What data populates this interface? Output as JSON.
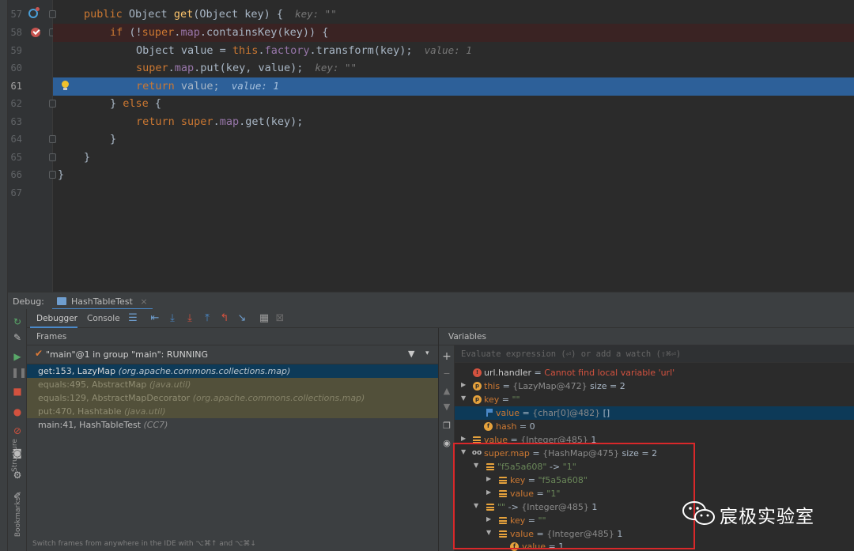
{
  "editor": {
    "lines": [
      {
        "num": "57",
        "code": {
          "kw1": "public",
          "t1": " Object ",
          "fn": "get",
          "t2": "(Object key) {",
          "hint": "  key: \"\""
        }
      },
      {
        "num": "58",
        "code": {
          "kw1": "if",
          "t1": " (!",
          "kw2": "super",
          "t2": ".",
          "fld": "map",
          "t3": ".containsKey(key)) {"
        }
      },
      {
        "num": "59",
        "code": {
          "t1": "Object value = ",
          "kw1": "this",
          "t2": ".",
          "fld": "factory",
          "t3": ".transform(key);",
          "hint": "  value: 1"
        }
      },
      {
        "num": "60",
        "code": {
          "kw1": "super",
          "t1": ".",
          "fld": "map",
          "t2": ".put(key, value);",
          "hint": "  key: \"\""
        }
      },
      {
        "num": "61",
        "code": {
          "kw1": "return",
          "t1": " value;",
          "hint": "  value: 1"
        }
      },
      {
        "num": "62",
        "code": {
          "t1": "} ",
          "kw1": "else",
          "t2": " {"
        }
      },
      {
        "num": "63",
        "code": {
          "kw1": "return",
          "t1": " ",
          "kw2": "super",
          "t2": ".",
          "fld": "map",
          "t3": ".get(key);"
        }
      },
      {
        "num": "64",
        "code": {
          "t1": "}"
        }
      },
      {
        "num": "65",
        "code": {
          "t1": "}"
        }
      },
      {
        "num": "66",
        "code": {
          "t1": "}"
        }
      },
      {
        "num": "67",
        "code": {
          "t1": ""
        }
      }
    ]
  },
  "debug": {
    "label": "Debug:",
    "tab": "HashTableTest",
    "close": "×",
    "toolbar": {
      "debugger": "Debugger",
      "console": "Console"
    },
    "side_labels": {
      "structure": "Structure",
      "bookmarks": "Bookmarks"
    }
  },
  "frames": {
    "header": "Frames",
    "thread": "\"main\"@1 in group \"main\": RUNNING",
    "items": [
      {
        "method": "get:153, LazyMap",
        "pkg": "(org.apache.commons.collections.map)"
      },
      {
        "method": "equals:495, AbstractMap",
        "pkg": "(java.util)"
      },
      {
        "method": "equals:129, AbstractMapDecorator",
        "pkg": "(org.apache.commons.collections.map)"
      },
      {
        "method": "put:470, Hashtable",
        "pkg": "(java.util)"
      },
      {
        "method": "main:41, HashTableTest",
        "pkg": "(CC7)"
      }
    ],
    "footer": "Switch frames from anywhere in the IDE with ⌥⌘↑ and ⌥⌘↓"
  },
  "variables": {
    "header": "Variables",
    "eval_placeholder": "Evaluate expression (⏎) or add a watch (⇧⌘⏎)",
    "rows": [
      {
        "name": "url.handler",
        "sep": " = ",
        "value": "Cannot find local variable 'url'"
      },
      {
        "name": "this",
        "sep": " = ",
        "type": "{LazyMap@472}",
        "extra": "  size = 2"
      },
      {
        "name": "key",
        "sep": " = ",
        "str": "\"\""
      },
      {
        "name": "value",
        "sep": " = ",
        "type": "{char[0]@482}",
        "extra": " []"
      },
      {
        "name": "hash",
        "sep": " = ",
        "extra": "0"
      },
      {
        "name": "value",
        "sep": " = ",
        "type": "{Integer@485}",
        "extra": " 1"
      },
      {
        "name": "super.map",
        "sep": " = ",
        "type": "{HashMap@475}",
        "extra": "  size = 2"
      },
      {
        "str": "\"f5a5a608\"",
        "sep": " -> ",
        "str2": "\"1\""
      },
      {
        "name": "key",
        "sep": " = ",
        "str": "\"f5a5a608\""
      },
      {
        "name": "value",
        "sep": " = ",
        "str": "\"1\""
      },
      {
        "str": "\"\"",
        "sep": " -> ",
        "type": "{Integer@485}",
        "extra": " 1"
      },
      {
        "name": "key",
        "sep": " = ",
        "str": "\"\""
      },
      {
        "name": "value",
        "sep": " = ",
        "type": "{Integer@485}",
        "extra": " 1"
      },
      {
        "name": "value",
        "sep": " = ",
        "extra": "1"
      }
    ]
  },
  "watermark": {
    "text": "宸极实验室"
  },
  "colors": {
    "accent": "#2d6099",
    "breakpoint": "#c75450",
    "highlight_box": "#d9282a"
  }
}
